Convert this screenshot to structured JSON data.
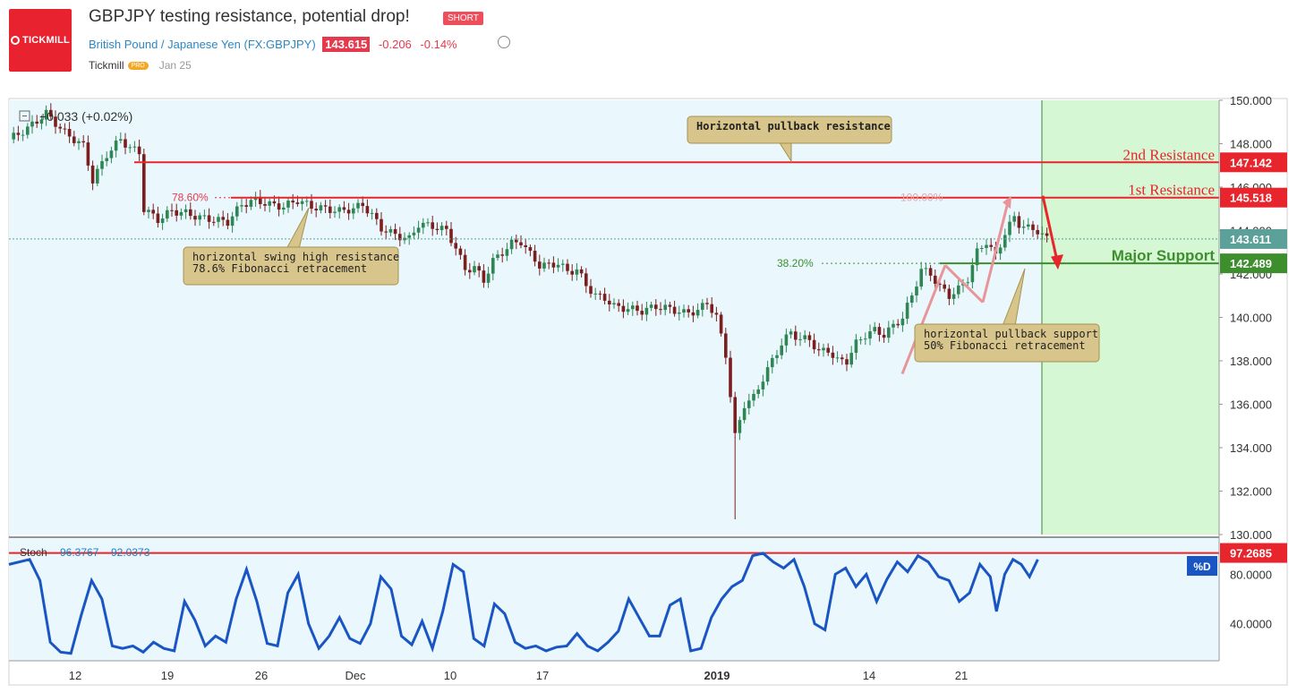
{
  "header": {
    "logo_text": "TICKMILL",
    "title": "GBPJPY testing resistance, potential drop!",
    "badge": "SHORT",
    "symbol_name": "British Pound / Japanese Yen",
    "symbol_code": "(FX:GBPJPY)",
    "price": "143.615",
    "change": "-0.206",
    "change_pct": "-0.14%",
    "author": "Tickmill",
    "author_badge": "PRO",
    "date": "Jan 25"
  },
  "chart_data": [
    {
      "type": "candlestick",
      "ylim": [
        130,
        150
      ],
      "y_ticks": [
        "150.000",
        "148.000",
        "146.000",
        "144.000",
        "142.000",
        "140.000",
        "138.000",
        "136.000",
        "134.000",
        "132.000",
        "130.000"
      ],
      "x_ticks": [
        "12",
        "19",
        "26",
        "Dec",
        "10",
        "17",
        "2019",
        "14",
        "21"
      ],
      "change_label": "+0.033 (+0.02%)",
      "price_path": [
        [
          0,
          148.2
        ],
        [
          4,
          148.7
        ],
        [
          8,
          149.4
        ],
        [
          12,
          148.5
        ],
        [
          16,
          147.9
        ],
        [
          18,
          146.3
        ],
        [
          21,
          147.5
        ],
        [
          24,
          148.2
        ],
        [
          26,
          147.8
        ],
        [
          28,
          147.6
        ],
        [
          29,
          145.0
        ],
        [
          32,
          144.5
        ],
        [
          35,
          144.9
        ],
        [
          38,
          144.8
        ],
        [
          41,
          144.6
        ],
        [
          44,
          144.5
        ],
        [
          47,
          144.4
        ],
        [
          50,
          145.2
        ],
        [
          53,
          145.4
        ],
        [
          56,
          145.2
        ],
        [
          59,
          145.1
        ],
        [
          62,
          145.4
        ],
        [
          65,
          145.1
        ],
        [
          68,
          145.0
        ],
        [
          71,
          144.9
        ],
        [
          74,
          145.0
        ],
        [
          76,
          145.2
        ],
        [
          78,
          144.7
        ],
        [
          80,
          144.1
        ],
        [
          83,
          143.8
        ],
        [
          86,
          143.6
        ],
        [
          88,
          144.3
        ],
        [
          91,
          144.2
        ],
        [
          94,
          144.0
        ],
        [
          96,
          143.2
        ],
        [
          98,
          142.2
        ],
        [
          100,
          142.3
        ],
        [
          102,
          141.7
        ],
        [
          104,
          142.6
        ],
        [
          106,
          143.0
        ],
        [
          108,
          143.4
        ],
        [
          110,
          143.5
        ],
        [
          112,
          142.9
        ],
        [
          114,
          142.4
        ],
        [
          116,
          142.4
        ],
        [
          118,
          142.5
        ],
        [
          120,
          142.1
        ],
        [
          122,
          142.2
        ],
        [
          124,
          141.5
        ],
        [
          126,
          141.0
        ],
        [
          128,
          140.9
        ],
        [
          130,
          140.5
        ],
        [
          133,
          140.4
        ],
        [
          136,
          140.3
        ],
        [
          139,
          140.5
        ],
        [
          142,
          140.4
        ],
        [
          145,
          140.2
        ],
        [
          148,
          140.3
        ],
        [
          150,
          140.7
        ],
        [
          152,
          140.0
        ],
        [
          154,
          138.3
        ],
        [
          156,
          134.5
        ],
        [
          158,
          136.0
        ],
        [
          160,
          136.3
        ],
        [
          162,
          137.2
        ],
        [
          164,
          138.0
        ],
        [
          166,
          138.8
        ],
        [
          168,
          139.3
        ],
        [
          170,
          139.0
        ],
        [
          172,
          139.0
        ],
        [
          174,
          138.4
        ],
        [
          176,
          138.5
        ],
        [
          178,
          138.0
        ],
        [
          180,
          138.0
        ],
        [
          182,
          138.8
        ],
        [
          184,
          139.2
        ],
        [
          186,
          139.4
        ],
        [
          188,
          139.2
        ],
        [
          190,
          139.6
        ],
        [
          192,
          140.0
        ],
        [
          194,
          141.0
        ],
        [
          196,
          142.2
        ],
        [
          198,
          142.0
        ],
        [
          200,
          141.4
        ],
        [
          202,
          141.0
        ],
        [
          204,
          141.3
        ],
        [
          206,
          141.8
        ],
        [
          208,
          143.0
        ],
        [
          210,
          143.5
        ],
        [
          212,
          142.8
        ],
        [
          214,
          143.9
        ],
        [
          216,
          144.6
        ],
        [
          217,
          144.3
        ],
        [
          219,
          144.1
        ],
        [
          221,
          144.0
        ],
        [
          223,
          143.6
        ]
      ],
      "stoch_window": [
        0,
        1,
        2,
        3
      ]
    },
    {
      "type": "line",
      "name": "Stoch",
      "values_label": [
        "96.3767",
        "92.0373"
      ],
      "ylim": [
        10,
        110
      ],
      "y_ticks": [
        "80.0000",
        "40.0000"
      ],
      "badge": "%D",
      "price_label": "97.2685",
      "points": [
        [
          0,
          88
        ],
        [
          10,
          92
        ],
        [
          15,
          75
        ],
        [
          20,
          25
        ],
        [
          25,
          17
        ],
        [
          30,
          16
        ],
        [
          35,
          47
        ],
        [
          40,
          75
        ],
        [
          45,
          60
        ],
        [
          50,
          22
        ],
        [
          55,
          20
        ],
        [
          60,
          22
        ],
        [
          65,
          17
        ],
        [
          70,
          25
        ],
        [
          75,
          20
        ],
        [
          80,
          18
        ],
        [
          85,
          58
        ],
        [
          90,
          43
        ],
        [
          95,
          22
        ],
        [
          100,
          30
        ],
        [
          105,
          25
        ],
        [
          110,
          60
        ],
        [
          115,
          84
        ],
        [
          120,
          58
        ],
        [
          125,
          24
        ],
        [
          130,
          22
        ],
        [
          135,
          65
        ],
        [
          140,
          80
        ],
        [
          145,
          40
        ],
        [
          150,
          20
        ],
        [
          155,
          30
        ],
        [
          160,
          45
        ],
        [
          165,
          28
        ],
        [
          170,
          24
        ],
        [
          175,
          40
        ],
        [
          180,
          78
        ],
        [
          185,
          68
        ],
        [
          190,
          30
        ],
        [
          195,
          23
        ],
        [
          200,
          42
        ],
        [
          205,
          20
        ],
        [
          210,
          50
        ],
        [
          215,
          88
        ],
        [
          220,
          82
        ],
        [
          225,
          28
        ],
        [
          230,
          22
        ],
        [
          235,
          56
        ],
        [
          240,
          48
        ],
        [
          245,
          25
        ],
        [
          250,
          20
        ],
        [
          255,
          22
        ],
        [
          260,
          18
        ],
        [
          265,
          21
        ],
        [
          270,
          22
        ],
        [
          275,
          32
        ],
        [
          280,
          22
        ],
        [
          285,
          18
        ],
        [
          290,
          25
        ],
        [
          295,
          34
        ],
        [
          300,
          60
        ],
        [
          305,
          45
        ],
        [
          310,
          30
        ],
        [
          315,
          30
        ],
        [
          320,
          55
        ],
        [
          325,
          60
        ],
        [
          330,
          18
        ],
        [
          335,
          20
        ],
        [
          340,
          45
        ],
        [
          345,
          60
        ],
        [
          350,
          70
        ],
        [
          355,
          75
        ],
        [
          360,
          95
        ],
        [
          365,
          97
        ],
        [
          370,
          90
        ],
        [
          375,
          85
        ],
        [
          380,
          92
        ],
        [
          385,
          70
        ],
        [
          390,
          40
        ],
        [
          395,
          35
        ],
        [
          400,
          80
        ],
        [
          405,
          85
        ],
        [
          410,
          70
        ],
        [
          415,
          80
        ],
        [
          420,
          58
        ],
        [
          425,
          76
        ],
        [
          430,
          90
        ],
        [
          435,
          82
        ],
        [
          440,
          95
        ],
        [
          445,
          90
        ],
        [
          450,
          78
        ],
        [
          455,
          75
        ],
        [
          460,
          58
        ],
        [
          465,
          65
        ],
        [
          470,
          88
        ],
        [
          475,
          78
        ],
        [
          478,
          50
        ],
        [
          482,
          80
        ],
        [
          486,
          92
        ],
        [
          490,
          88
        ],
        [
          494,
          78
        ],
        [
          498,
          92
        ]
      ]
    }
  ],
  "levels": {
    "resistance2": {
      "label": "2nd Resistance",
      "price": "147.142",
      "value": 147.142,
      "color": "#e8242c"
    },
    "resistance1": {
      "label": "1st Resistance",
      "price": "145.518",
      "value": 145.518,
      "color": "#e8242c"
    },
    "support": {
      "label": "Major Support",
      "price": "142.489",
      "value": 142.489,
      "color": "#3d8f2e"
    },
    "current": {
      "price": "143.611",
      "value": 143.611,
      "color": "#5ba199"
    }
  },
  "fib_labels": {
    "fib786": "78.60%",
    "fib100": "100.00%",
    "fib382": "38.20%"
  },
  "annotations": {
    "callout1": "Horizontal pullback resistance",
    "callout2_line1": "horizontal swing high resistance",
    "callout2_line2": "78.6% Fibonacci retracement",
    "callout3_line1": "horizontal pullback support",
    "callout3_line2": "50% Fibonacci retracement"
  },
  "colors": {
    "chart_bg": "#eaf8fd",
    "forecast_bg": "#d6f7d3",
    "candle_up": "#2d8653",
    "candle_down": "#7b1e1e",
    "stoch": "#1a55c4"
  }
}
